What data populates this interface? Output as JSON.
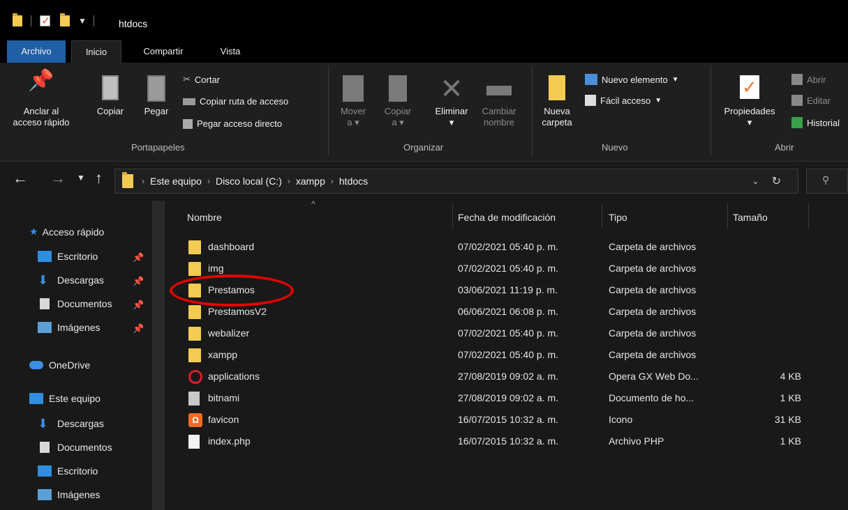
{
  "window": {
    "title": "htdocs"
  },
  "ribbon_tabs": [
    "Archivo",
    "Inicio",
    "Compartir",
    "Vista"
  ],
  "ribbon": {
    "portapapeles": {
      "label": "Portapapeles",
      "pin": "Anclar al\nacceso rápido",
      "pin_l1": "Anclar al",
      "pin_l2": "acceso rápido",
      "copy": "Copiar",
      "paste": "Pegar",
      "cut": "Cortar",
      "copy_path": "Copiar ruta de acceso",
      "paste_shortcut": "Pegar acceso directo"
    },
    "organizar": {
      "label": "Organizar",
      "move_l1": "Mover",
      "move_l2": "a",
      "copy_l1": "Copiar",
      "copy_l2": "a",
      "delete": "Eliminar",
      "rename_l1": "Cambiar",
      "rename_l2": "nombre"
    },
    "nuevo": {
      "label": "Nuevo",
      "folder_l1": "Nueva",
      "folder_l2": "carpeta",
      "new_item": "Nuevo elemento",
      "easy_access": "Fácil acceso"
    },
    "abrir": {
      "label": "Abrir",
      "properties": "Propiedades",
      "open": "Abrir",
      "edit": "Editar",
      "history": "Historial"
    }
  },
  "address": {
    "crumbs": [
      "Este equipo",
      "Disco local (C:)",
      "xampp",
      "htdocs"
    ]
  },
  "nav": {
    "quick_access": "Acceso rápido",
    "items": [
      {
        "label": "Escritorio",
        "icon": "desktop-icon",
        "pinned": true
      },
      {
        "label": "Descargas",
        "icon": "download-icon",
        "pinned": true
      },
      {
        "label": "Documentos",
        "icon": "document-icon",
        "pinned": true
      },
      {
        "label": "Imágenes",
        "icon": "image-icon",
        "pinned": true
      }
    ],
    "onedrive": "OneDrive",
    "this_pc": "Este equipo",
    "pc_items": [
      "Descargas",
      "Documentos",
      "Escritorio",
      "Imágenes"
    ]
  },
  "columns": {
    "name": "Nombre",
    "date": "Fecha de modificación",
    "type": "Tipo",
    "size": "Tamaño"
  },
  "files": [
    {
      "name": "dashboard",
      "date": "07/02/2021 05:40 p. m.",
      "type": "Carpeta de archivos",
      "size": "",
      "icon": "folder-icon"
    },
    {
      "name": "img",
      "date": "07/02/2021 05:40 p. m.",
      "type": "Carpeta de archivos",
      "size": "",
      "icon": "folder-icon"
    },
    {
      "name": "Prestamos",
      "date": "03/06/2021 11:19 p. m.",
      "type": "Carpeta de archivos",
      "size": "",
      "icon": "folder-icon"
    },
    {
      "name": "PrestamosV2",
      "date": "06/06/2021 06:08 p. m.",
      "type": "Carpeta de archivos",
      "size": "",
      "icon": "folder-icon"
    },
    {
      "name": "webalizer",
      "date": "07/02/2021 05:40 p. m.",
      "type": "Carpeta de archivos",
      "size": "",
      "icon": "folder-icon"
    },
    {
      "name": "xampp",
      "date": "07/02/2021 05:40 p. m.",
      "type": "Carpeta de archivos",
      "size": "",
      "icon": "folder-icon"
    },
    {
      "name": "applications",
      "date": "27/08/2019 09:02 a. m.",
      "type": "Opera GX Web Do...",
      "size": "4 KB",
      "icon": "opera-icon"
    },
    {
      "name": "bitnami",
      "date": "27/08/2019 09:02 a. m.",
      "type": "Documento de ho...",
      "size": "1 KB",
      "icon": "stylesheet-icon"
    },
    {
      "name": "favicon",
      "date": "16/07/2015 10:32 a. m.",
      "type": "Icono",
      "size": "31 KB",
      "icon": "xampp-icon"
    },
    {
      "name": "index.php",
      "date": "16/07/2015 10:32 a. m.",
      "type": "Archivo PHP",
      "size": "1 KB",
      "icon": "php-file-icon"
    }
  ],
  "colors": {
    "accent": "#1f5fa6",
    "highlight": "#e60000",
    "folder": "#f3cb53",
    "background": "#191919"
  }
}
